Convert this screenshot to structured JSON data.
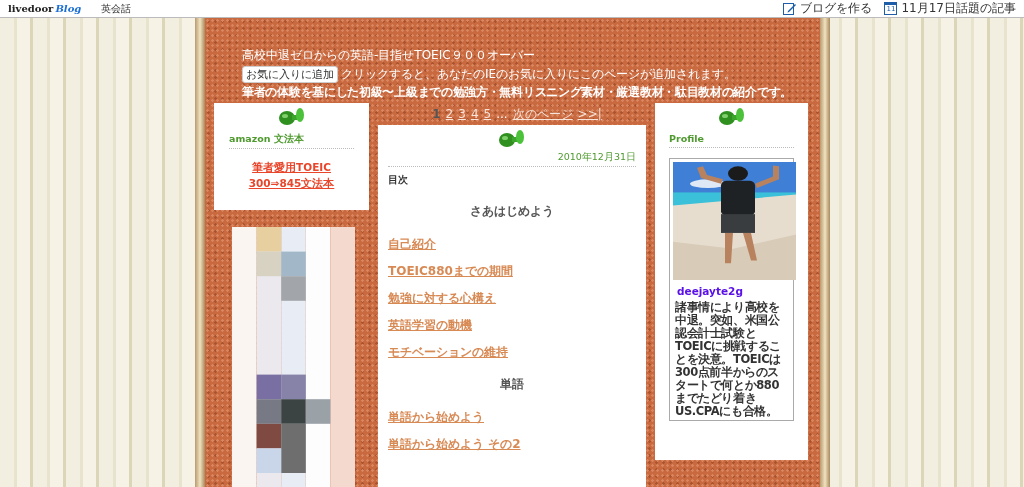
{
  "topbar": {
    "logo": "livedoor",
    "logo_suffix": "Blog",
    "blog_name": "英会話",
    "links": [
      {
        "kind": "pen",
        "label": "ブログを作る"
      },
      {
        "kind": "calendar",
        "calendar_day": "11",
        "label": "11月17日話題の記事"
      }
    ]
  },
  "header": {
    "title": "高校中退ゼロからの英語-目指せTOEIC９００オーバー",
    "favorite_button": "お気に入りに追加",
    "favorite_note": "クリックすると、あなたのIEのお気に入りにこのページが追加されます。",
    "description": "筆者の体験を基にした初級〜上級までの勉強方・無料リスニング素材・厳選教材・駄目教材の紹介です。"
  },
  "pagination": {
    "pages": [
      {
        "label": "1",
        "selected": true
      },
      {
        "label": "2",
        "selected": false
      },
      {
        "label": "3",
        "selected": false
      },
      {
        "label": "4",
        "selected": false
      },
      {
        "label": "5",
        "selected": false
      }
    ],
    "ellipsis": "...",
    "next": "次のページ",
    "last": ">>|"
  },
  "left_widget": {
    "title": "amazon 文法本",
    "link_lines": [
      "筆者愛用TOEIC",
      "300⇒845文法本"
    ]
  },
  "article": {
    "date": "2010年12月31日",
    "heading": "目次",
    "items": [
      {
        "kind": "section",
        "text": "さあはじめよう"
      },
      {
        "kind": "link",
        "text": "自己紹介"
      },
      {
        "kind": "link",
        "text": "TOEIC880までの期間"
      },
      {
        "kind": "link",
        "text": "勉強に対する心構え"
      },
      {
        "kind": "link",
        "text": "英語学習の動機"
      },
      {
        "kind": "link",
        "text": "モチベーションの維持"
      },
      {
        "kind": "section",
        "text": "単語"
      },
      {
        "kind": "link",
        "text": "単語から始めよう"
      },
      {
        "kind": "link",
        "text": "単語から始めよう その2"
      }
    ]
  },
  "profile": {
    "title": "Profile",
    "name": "deejayte2g",
    "bio": "諸事情により高校を中退。突如、米国公認会計士試験とTOEICに挑戦することを決意。TOEICは300点前半からのスタートで何とか880までたどり着きUS.CPAにも合格。"
  }
}
